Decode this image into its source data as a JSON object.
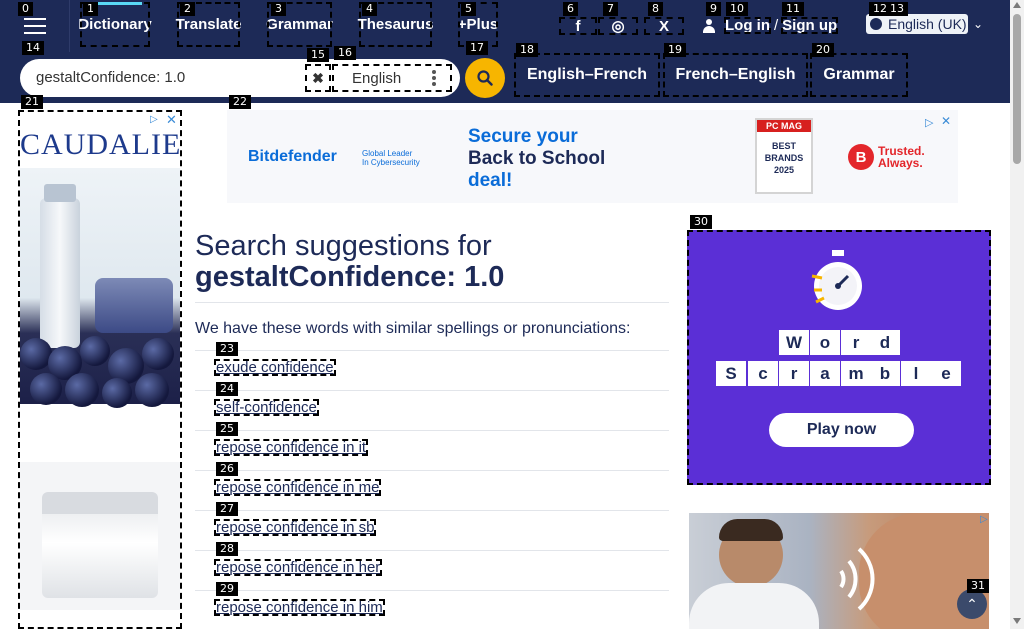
{
  "nav": {
    "items": [
      {
        "label": "Dictionary",
        "active": true
      },
      {
        "label": "Translate"
      },
      {
        "label": "Grammar"
      },
      {
        "label": "Thesaurus"
      },
      {
        "label": "+Plus"
      }
    ],
    "social": [
      {
        "icon": "facebook-icon",
        "glyph": "f"
      },
      {
        "icon": "instagram-icon",
        "glyph": "◎"
      },
      {
        "icon": "x-icon",
        "glyph": "X"
      }
    ],
    "login_label": "Log in",
    "login_sep": "/",
    "signup_label": "Sign up",
    "language": "English (UK)"
  },
  "search": {
    "value": "gestaltConfidence: 1.0",
    "dictionary_select": "English",
    "tabs": [
      "English–French",
      "French–English",
      "Grammar"
    ]
  },
  "ads": {
    "left": {
      "brand": "CAUDALIE"
    },
    "top": {
      "brand": "Bitdefender",
      "brand_sub": [
        "Global Leader",
        "In Cybersecurity"
      ],
      "headline": [
        "Secure your",
        "Back to School",
        "deal!"
      ],
      "badge_top": "PC MAG",
      "badge_mid": "BEST BRANDS",
      "badge_year": "2025",
      "trusted": [
        "Trusted.",
        "Always."
      ]
    },
    "word": {
      "row1": [
        "W",
        "o",
        "r",
        "d"
      ],
      "row2": [
        "S",
        "c",
        "r",
        "a",
        "m",
        "b",
        "l",
        "e"
      ],
      "cta": "Play now"
    }
  },
  "main": {
    "title_prefix": "Search suggestions for",
    "title_query": "gestaltConfidence: 1.0",
    "intro": "We have these words with similar spellings or pronunciations:",
    "suggestions": [
      "exude confidence",
      "self-confidence",
      "repose confidence in it",
      "repose confidence in me",
      "repose confidence in sb",
      "repose confidence in her",
      "repose confidence in him"
    ]
  },
  "labels": [
    "0",
    "1",
    "2",
    "3",
    "4",
    "5",
    "6",
    "7",
    "8",
    "9",
    "10",
    "11",
    "12",
    "13",
    "14",
    "15",
    "16",
    "17",
    "18",
    "19",
    "20",
    "21",
    "22",
    "23",
    "24",
    "25",
    "26",
    "27",
    "28",
    "29",
    "30",
    "31"
  ],
  "colors": {
    "nav_bg": "#1d2a57",
    "accent": "#f7b500",
    "active_bar": "#5ad8f5",
    "word_ad": "#5b2fd6"
  }
}
